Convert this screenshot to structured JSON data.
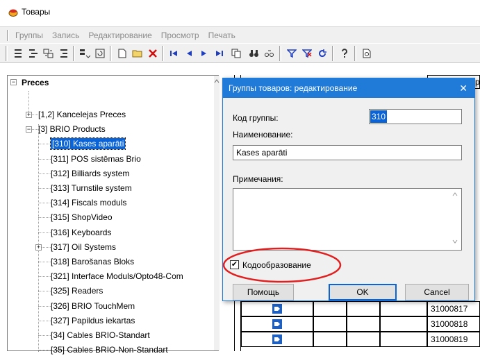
{
  "window": {
    "title": "Товары"
  },
  "menu": {
    "items": [
      "Группы",
      "Запись",
      "Редактирование",
      "Просмотр",
      "Печать"
    ]
  },
  "tree": {
    "root_label": "Preces",
    "nodes": [
      {
        "label": "[1,2] Kancelejas Preces",
        "level": 1,
        "expander": "+"
      },
      {
        "label": "[3] BRIO Products",
        "level": 1,
        "expander": "-"
      },
      {
        "label": "[310] Kases aparāti",
        "level": 2,
        "selected": true
      },
      {
        "label": "[311] POS sistēmas Brio",
        "level": 2
      },
      {
        "label": "[312] Billiards system",
        "level": 2
      },
      {
        "label": "[313] Turnstile system",
        "level": 2
      },
      {
        "label": "[314] Fiscals moduls",
        "level": 2
      },
      {
        "label": "[315] ShopVideo",
        "level": 2
      },
      {
        "label": "[316] Keyboards",
        "level": 2
      },
      {
        "label": "[317] Oil Systems",
        "level": 2,
        "expander": "+"
      },
      {
        "label": "[318] Barošanas Bloks",
        "level": 2
      },
      {
        "label": "[321] Interface Moduls/Opto48-Com",
        "level": 2
      },
      {
        "label": "[325] Readers",
        "level": 2
      },
      {
        "label": "[326] BRIO TouchMem",
        "level": 2
      },
      {
        "label": "[327] Papildus iekartas",
        "level": 2
      },
      {
        "label": "[34] Cables BRIO-Standart",
        "level": 2
      },
      {
        "label": "[35] Cables BRIO-Non-Standart",
        "level": 2
      }
    ]
  },
  "grid": {
    "header_partial": "ра",
    "codes": [
      "31000817",
      "31000818",
      "31000819"
    ]
  },
  "dialog": {
    "title": "Группы товаров: редактирование",
    "code_label": "Код группы:",
    "code_value": "310",
    "name_label": "Наименование:",
    "name_value": "Kases aparāti",
    "notes_label": "Примечания:",
    "notes_value": "",
    "checkbox_label": "Кодообразование",
    "checkbox_checked": true,
    "help_button": "Помощь",
    "ok_button": "OK",
    "cancel_button": "Cancel"
  },
  "colors": {
    "accent": "#1f7ad8",
    "selection": "#0a64d8",
    "highlight_circle": "#e02020"
  }
}
